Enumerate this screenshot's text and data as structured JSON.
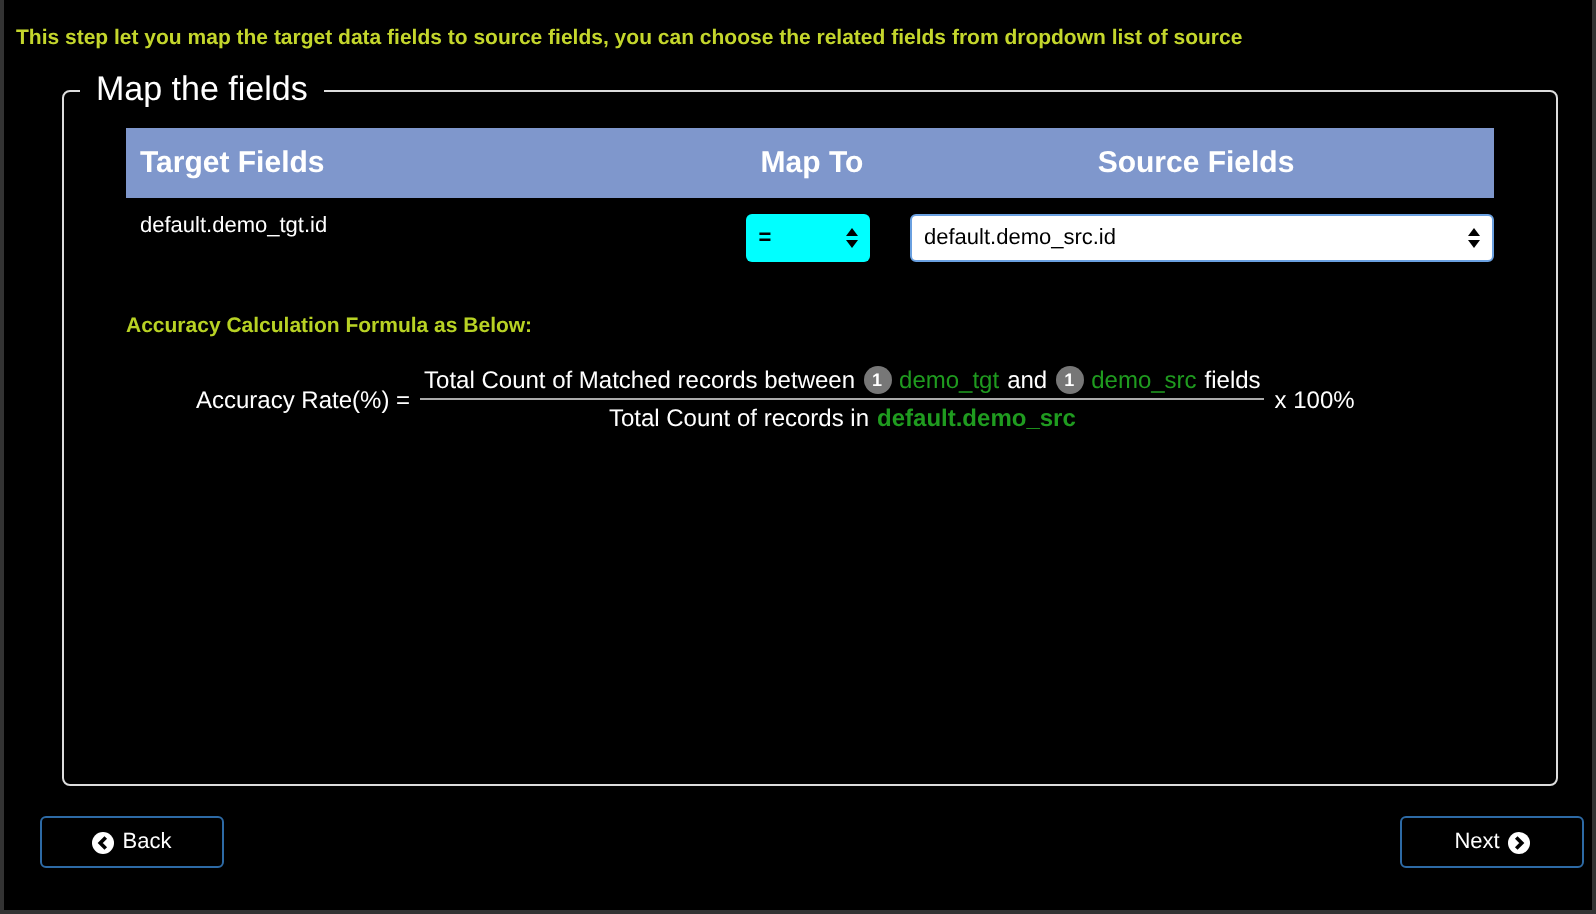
{
  "instruction": "This step let you map the target data fields to source fields, you can choose the related fields from dropdown list of source",
  "fieldset": {
    "legend": "Map the fields"
  },
  "table": {
    "columns": [
      "Target Fields",
      "Map To",
      "Source Fields"
    ],
    "rows": [
      {
        "target": "default.demo_tgt.id",
        "operator": "=",
        "source": "default.demo_src.id"
      }
    ]
  },
  "formula": {
    "heading": "Accuracy Calculation Formula as Below:",
    "label": "Accuracy Rate(%) =",
    "numerator": [
      {
        "kind": "text",
        "text": "Total Count of Matched records between"
      },
      {
        "kind": "badge",
        "text": "1"
      },
      {
        "kind": "table",
        "text": "demo_tgt"
      },
      {
        "kind": "text",
        "text": "and"
      },
      {
        "kind": "badge",
        "text": "1"
      },
      {
        "kind": "table",
        "text": "demo_src"
      },
      {
        "kind": "text",
        "text": "fields"
      }
    ],
    "denominator": [
      {
        "kind": "text",
        "text": "Total Count of records in"
      },
      {
        "kind": "strong-table",
        "text": "default.demo_src"
      }
    ],
    "multiplier": "x 100%"
  },
  "buttons": {
    "back": "Back",
    "next": "Next"
  }
}
